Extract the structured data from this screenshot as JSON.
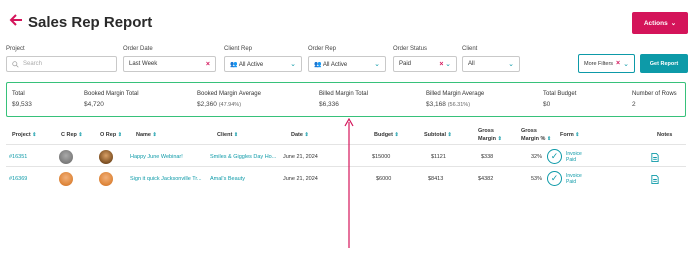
{
  "header": {
    "title": "Sales Rep Report",
    "actions_label": "Actions"
  },
  "filters": {
    "project": {
      "label": "Project",
      "placeholder": "Search"
    },
    "order_date": {
      "label": "Order Date",
      "value": "Last Week"
    },
    "client_rep": {
      "label": "Client Rep",
      "value": "All Active"
    },
    "order_rep": {
      "label": "Order Rep",
      "value": "All Active"
    },
    "order_status": {
      "label": "Order Status",
      "value": "Paid"
    },
    "client": {
      "label": "Client",
      "value": "All"
    },
    "more_filters_label": "More Filters",
    "get_report_label": "Get Report"
  },
  "summary": [
    {
      "label": "Total",
      "value": "$9,533",
      "pct": ""
    },
    {
      "label": "Booked Margin Total",
      "value": "$4,720",
      "pct": ""
    },
    {
      "label": "Booked Margin Average",
      "value": "$2,360",
      "pct": "(47.94%)"
    },
    {
      "label": "Billed Margin Total",
      "value": "$6,336",
      "pct": ""
    },
    {
      "label": "Billed Margin Average",
      "value": "$3,168",
      "pct": "(56.31%)"
    },
    {
      "label": "Total Budget",
      "value": "$0",
      "pct": ""
    },
    {
      "label": "Number of Rows",
      "value": "2",
      "pct": ""
    }
  ],
  "table": {
    "headers": {
      "project": "Project",
      "c_rep": "C Rep",
      "o_rep": "O Rep",
      "name": "Name",
      "client": "Client",
      "date": "Date",
      "budget": "Budget",
      "subtotal": "Subtotal",
      "gross_margin_a": "Gross",
      "gross_margin_b": "Margin",
      "gross_margin_pct_a": "Gross",
      "gross_margin_pct_b": "Margin %",
      "form": "Form",
      "notes": "Notes"
    },
    "rows": [
      {
        "project": "#16351",
        "name": "Happy June Webinar!",
        "client": "Smiles & Giggles Day Ho...",
        "date": "June 21, 2024",
        "budget": "$15000",
        "subtotal": "$1121",
        "gross_margin": "$338",
        "gross_margin_pct": "32%",
        "form_a": "Invoice",
        "form_b": "Paid"
      },
      {
        "project": "#16369",
        "name": "Sign it quick Jacksonville Tr...",
        "client": "Amal's Beauty",
        "date": "June 21, 2024",
        "budget": "$6000",
        "subtotal": "$8413",
        "gross_margin": "$4382",
        "gross_margin_pct": "53%",
        "form_a": "Invoice",
        "form_b": "Paid"
      }
    ]
  },
  "colors": {
    "accent": "#0d9aa8",
    "actions": "#d4145a",
    "summary_border": "#37c17a",
    "arrow": "#d4145a"
  },
  "icons": [
    "back-arrow-icon",
    "search-icon",
    "calendar-icon",
    "users-icon",
    "chevron-down-icon",
    "clear-x-icon",
    "sort-icon",
    "check-circle-icon",
    "document-icon"
  ]
}
